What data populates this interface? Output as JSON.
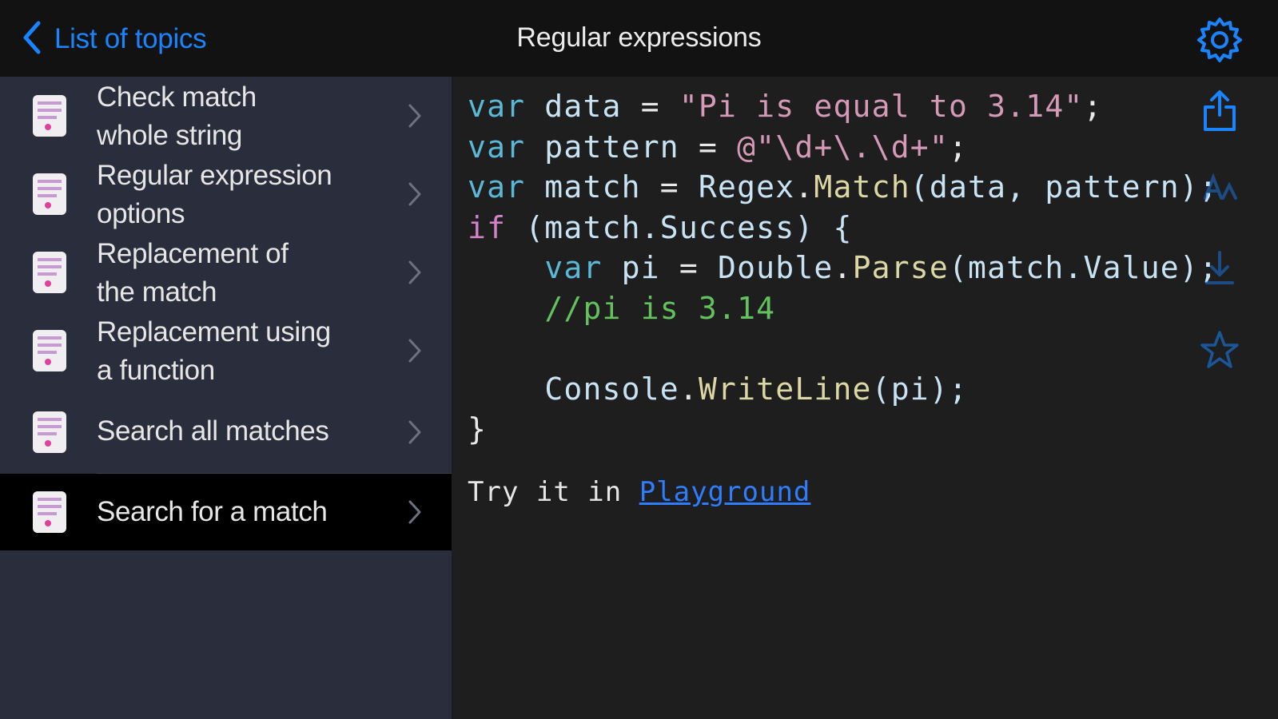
{
  "nav": {
    "back_label": "List of topics",
    "title": "Regular expressions"
  },
  "sidebar": {
    "items": [
      {
        "line1": "Check match",
        "line2": "whole string",
        "selected": false
      },
      {
        "line1": "Regular expression",
        "line2": "options",
        "selected": false
      },
      {
        "line1": "Replacement of",
        "line2": "the match",
        "selected": false
      },
      {
        "line1": "Replacement using",
        "line2": "a function",
        "selected": false
      },
      {
        "line1": "Search all matches",
        "line2": "",
        "selected": false
      },
      {
        "line1": "Search for a match",
        "line2": "",
        "selected": true
      }
    ]
  },
  "code": {
    "line1": {
      "kw": "var",
      "name": " data ",
      "op": "=",
      "str": " \"Pi is equal to 3.14\"",
      "end": ";"
    },
    "line2": {
      "kw": "var",
      "name": " pattern ",
      "op": "=",
      "str": " @\"\\d+\\.\\d+\"",
      "end": ";"
    },
    "line3": {
      "kw": "var",
      "name": " match ",
      "op": "=",
      "cls": " Regex",
      "dot": ".",
      "fn": "Match",
      "args": "(data, pattern);"
    },
    "line4": {
      "kw": "if",
      "rest": " (match.Success) {"
    },
    "line5": {
      "indent": "    ",
      "kw": "var",
      "name": " pi ",
      "op": "=",
      "cls": " Double",
      "dot": ".",
      "fn": "Parse",
      "args": "(match.Value);"
    },
    "line6": {
      "indent": "    ",
      "comment": "//pi is 3.14"
    },
    "line7": "",
    "line8": {
      "indent": "    ",
      "cls": "Console",
      "dot": ".",
      "fn": "WriteLine",
      "args": "(pi);"
    },
    "line9": "}"
  },
  "try": {
    "prefix": "Try it in ",
    "link": "Playground"
  },
  "colors": {
    "accent": "#1a84ff",
    "sidebar_bg": "#2a2d3b",
    "selected_bg": "#000000",
    "keyword": "#5bb8d6",
    "string": "#d49ab6",
    "comment": "#63c15e",
    "function": "#dcd8a6"
  },
  "icons": [
    "chevron-left-icon",
    "gear-icon",
    "document-code-icon",
    "chevron-right-icon",
    "share-icon",
    "font-size-icon",
    "download-icon",
    "star-icon"
  ]
}
